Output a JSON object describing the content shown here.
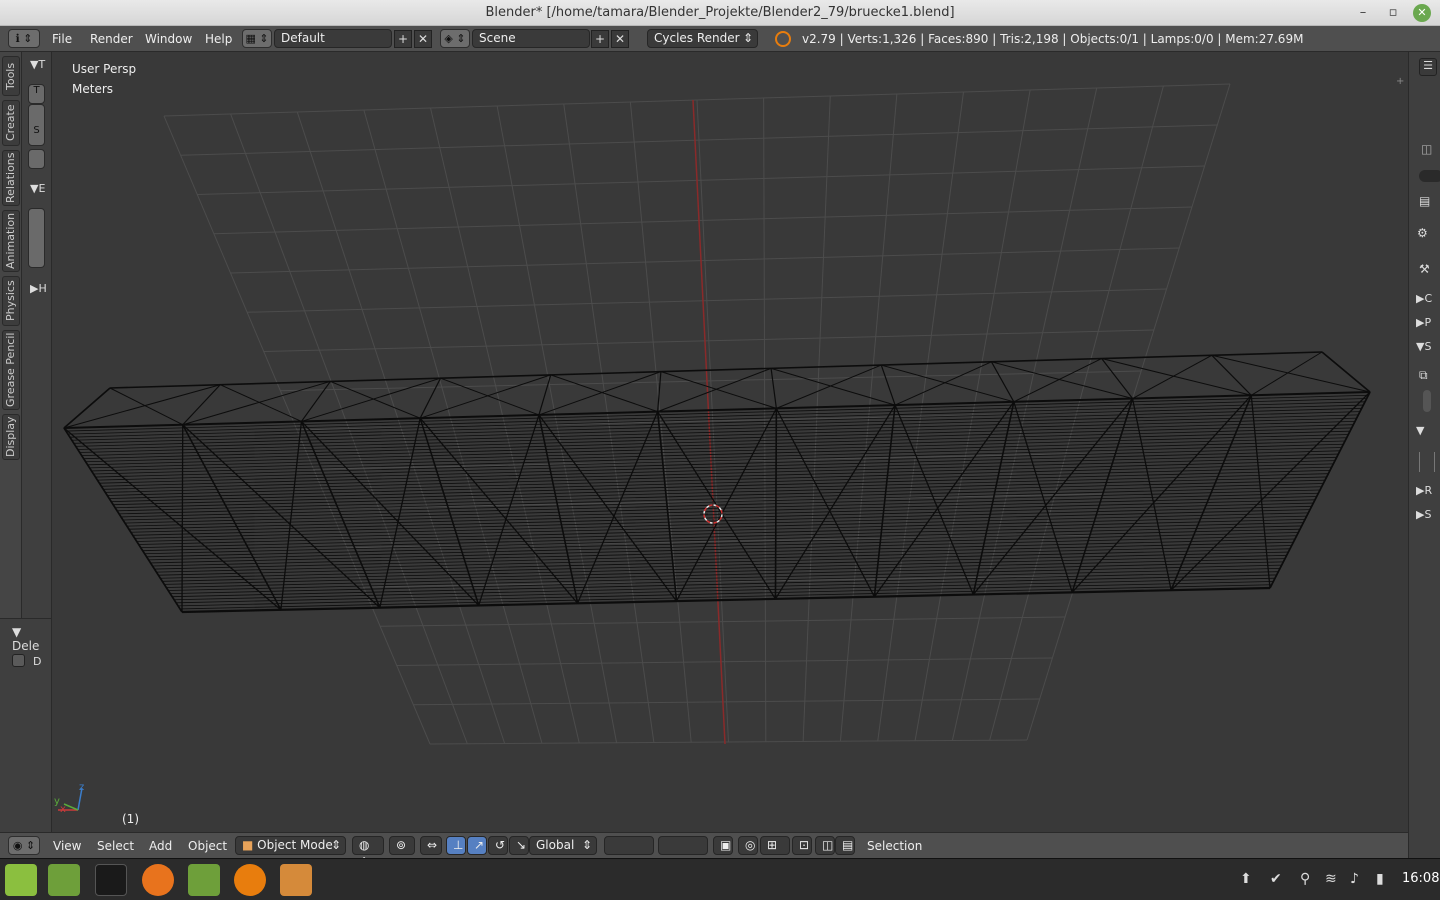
{
  "window": {
    "title": "Blender* [/home/tamara/Blender_Projekte/Blender2_79/bruecke1.blend]",
    "controls": {
      "minimize": "–",
      "restore": "▫",
      "close": "✕"
    }
  },
  "menubar": {
    "info_icon": "ℹ",
    "menus": [
      "File",
      "Render",
      "Window",
      "Help"
    ],
    "layout_name": "Default",
    "scene_name": "Scene",
    "render_engine": "Cycles Render",
    "stats": "v2.79 | Verts:1,326 | Faces:890 | Tris:2,198 | Objects:0/1 | Lamps:0/0 | Mem:27.69M"
  },
  "tool_tabs": [
    "Tools",
    "Create",
    "Relations",
    "Animation",
    "Physics",
    "Grease Pencil",
    "Display"
  ],
  "toolshelf": {
    "headers": [
      "T",
      "E",
      "H"
    ],
    "buttons": [
      "T",
      "S"
    ]
  },
  "operator_panel": {
    "title": "Dele",
    "checkbox_label": "D"
  },
  "viewport": {
    "view_name": "User Persp",
    "units": "Meters",
    "frame": "(1)",
    "axes": {
      "x": "x",
      "y": "y",
      "z": "z"
    }
  },
  "rightbar": {
    "labels": [
      "C",
      "P",
      "S",
      "R",
      "S"
    ]
  },
  "bottombar": {
    "view": "View",
    "select": "Select",
    "add": "Add",
    "object": "Object",
    "mode": "Object Mode",
    "orientation": "Global",
    "status": "Selection"
  },
  "taskbar": {
    "clock": "16:08"
  },
  "colors": {
    "header": "#4f4f4f",
    "viewport": "#393939",
    "grid": "#4a4a4a",
    "y_axis": "#8a2a2a",
    "wire": "#0b0b0b"
  }
}
